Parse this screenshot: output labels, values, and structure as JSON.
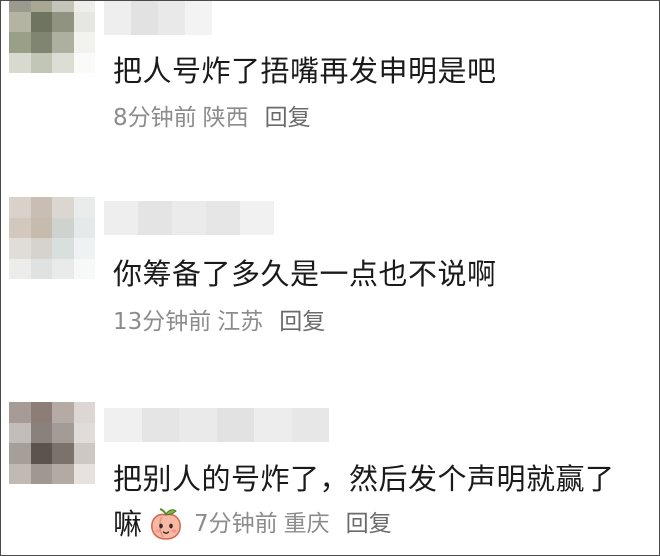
{
  "comments": [
    {
      "text": "把人号炸了捂嘴再发申明是吧",
      "time": "8分钟前",
      "location": "陕西",
      "reply_label": "回复"
    },
    {
      "text": "你筹备了多久是一点也不说啊",
      "time": "13分钟前",
      "location": "江苏",
      "reply_label": "回复"
    },
    {
      "text_line1": "把别人的号炸了，然后发个声明就赢了",
      "text_line2": "嘛",
      "time": "7分钟前",
      "location": "重庆",
      "reply_label": "回复",
      "emoji_icon": "peach-face-emoji"
    }
  ]
}
